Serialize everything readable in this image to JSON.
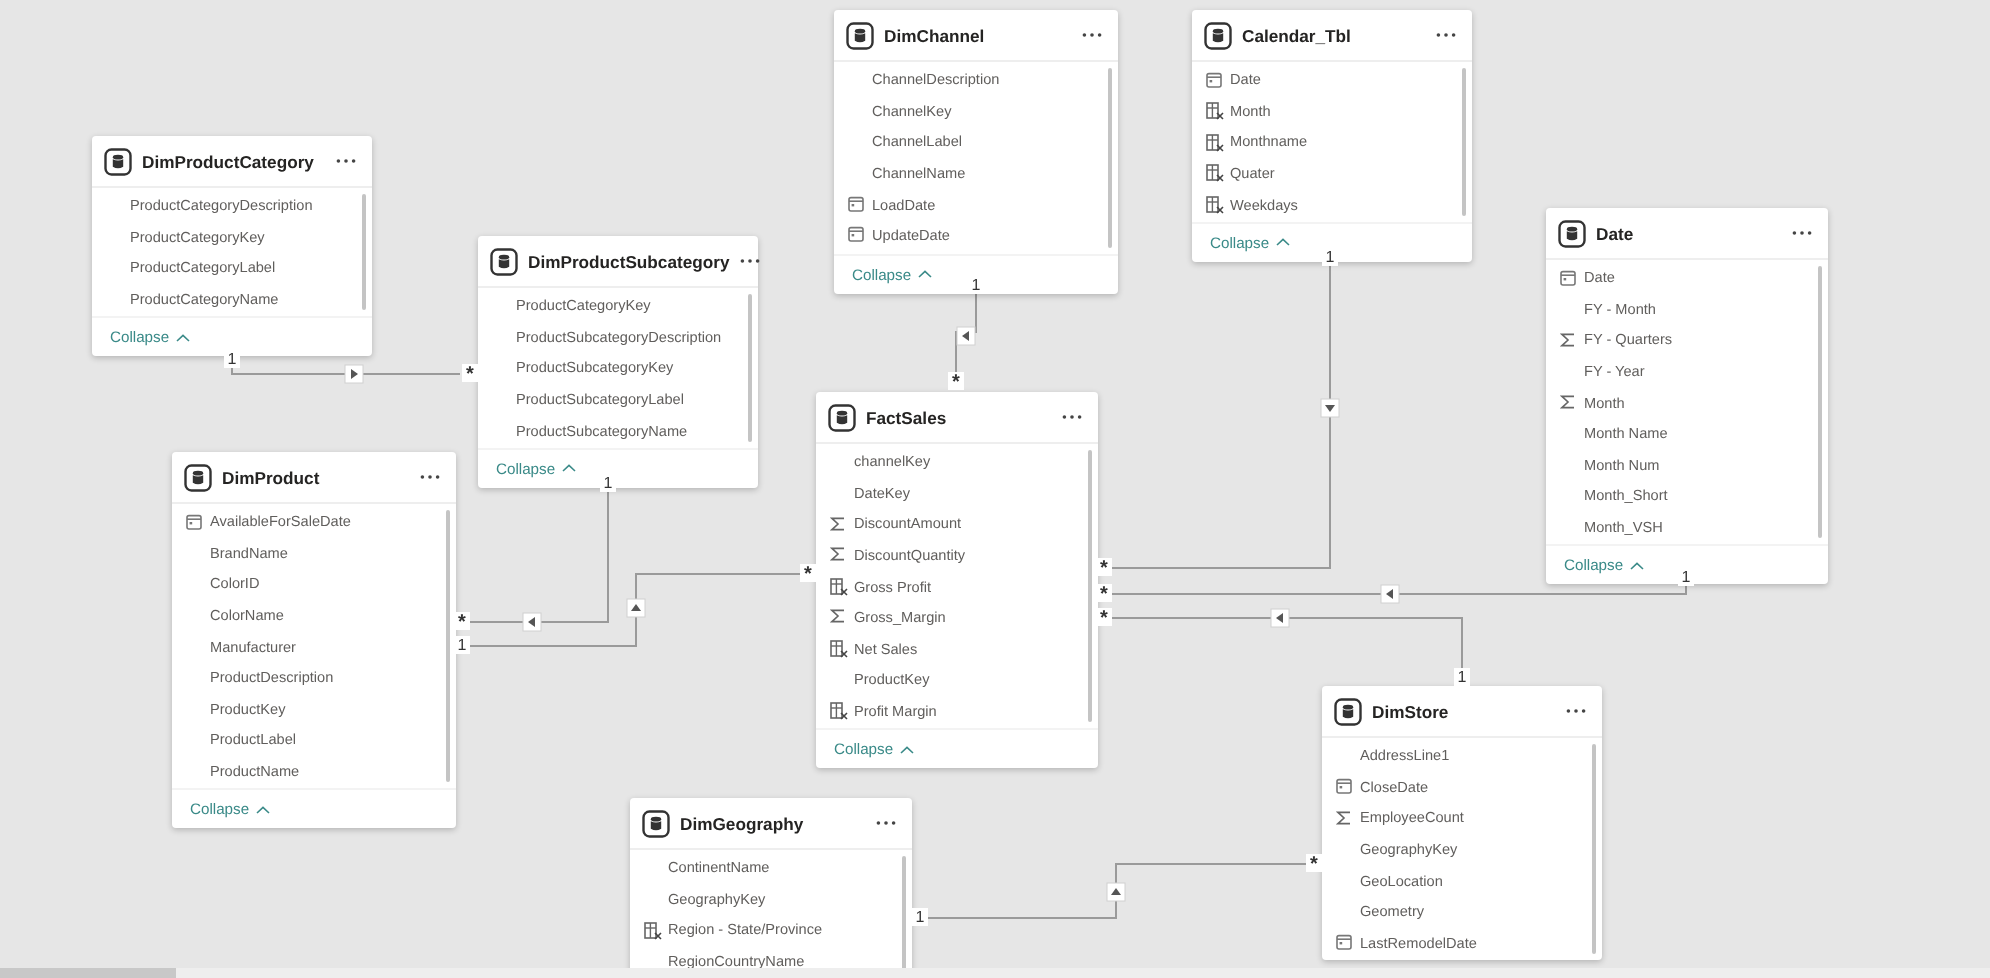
{
  "tables": [
    {
      "name": "DimProductCategory",
      "columns": [
        {
          "name": "ProductCategoryDescription",
          "kind": "plain"
        },
        {
          "name": "ProductCategoryKey",
          "kind": "plain"
        },
        {
          "name": "ProductCategoryLabel",
          "kind": "plain"
        },
        {
          "name": "ProductCategoryName",
          "kind": "plain"
        }
      ],
      "collapse": "Collapse"
    },
    {
      "name": "DimProductSubcategory",
      "columns": [
        {
          "name": "ProductCategoryKey",
          "kind": "plain"
        },
        {
          "name": "ProductSubcategoryDescription",
          "kind": "plain"
        },
        {
          "name": "ProductSubcategoryKey",
          "kind": "plain"
        },
        {
          "name": "ProductSubcategoryLabel",
          "kind": "plain"
        },
        {
          "name": "ProductSubcategoryName",
          "kind": "plain"
        }
      ],
      "collapse": "Collapse"
    },
    {
      "name": "DimProduct",
      "columns": [
        {
          "name": "AvailableForSaleDate",
          "kind": "date"
        },
        {
          "name": "BrandName",
          "kind": "plain"
        },
        {
          "name": "ColorID",
          "kind": "plain"
        },
        {
          "name": "ColorName",
          "kind": "plain"
        },
        {
          "name": "Manufacturer",
          "kind": "plain"
        },
        {
          "name": "ProductDescription",
          "kind": "plain"
        },
        {
          "name": "ProductKey",
          "kind": "plain"
        },
        {
          "name": "ProductLabel",
          "kind": "plain"
        },
        {
          "name": "ProductName",
          "kind": "plain"
        }
      ],
      "collapse": "Collapse"
    },
    {
      "name": "DimChannel",
      "columns": [
        {
          "name": "ChannelDescription",
          "kind": "plain"
        },
        {
          "name": "ChannelKey",
          "kind": "plain"
        },
        {
          "name": "ChannelLabel",
          "kind": "plain"
        },
        {
          "name": "ChannelName",
          "kind": "plain"
        },
        {
          "name": "LoadDate",
          "kind": "date"
        },
        {
          "name": "UpdateDate",
          "kind": "date"
        }
      ],
      "collapse": "Collapse"
    },
    {
      "name": "Calendar_Tbl",
      "columns": [
        {
          "name": "Date",
          "kind": "date"
        },
        {
          "name": "Month",
          "kind": "calc"
        },
        {
          "name": "Monthname",
          "kind": "calc"
        },
        {
          "name": "Quater",
          "kind": "calc"
        },
        {
          "name": "Weekdays",
          "kind": "calc"
        }
      ],
      "collapse": "Collapse"
    },
    {
      "name": "Date",
      "columns": [
        {
          "name": "Date",
          "kind": "date"
        },
        {
          "name": "FY - Month",
          "kind": "plain"
        },
        {
          "name": "FY - Quarters",
          "kind": "sum"
        },
        {
          "name": "FY - Year",
          "kind": "plain"
        },
        {
          "name": "Month",
          "kind": "sum"
        },
        {
          "name": "Month Name",
          "kind": "plain"
        },
        {
          "name": "Month Num",
          "kind": "plain"
        },
        {
          "name": "Month_Short",
          "kind": "plain"
        },
        {
          "name": "Month_VSH",
          "kind": "plain"
        }
      ],
      "collapse": "Collapse"
    },
    {
      "name": "FactSales",
      "columns": [
        {
          "name": "channelKey",
          "kind": "plain"
        },
        {
          "name": "DateKey",
          "kind": "plain"
        },
        {
          "name": "DiscountAmount",
          "kind": "sum"
        },
        {
          "name": "DiscountQuantity",
          "kind": "sum"
        },
        {
          "name": "Gross Profit",
          "kind": "calc"
        },
        {
          "name": "Gross_Margin",
          "kind": "sum"
        },
        {
          "name": "Net Sales",
          "kind": "calc"
        },
        {
          "name": "ProductKey",
          "kind": "plain"
        },
        {
          "name": "Profit Margin",
          "kind": "calc"
        }
      ],
      "collapse": "Collapse"
    },
    {
      "name": "DimStore",
      "columns": [
        {
          "name": "AddressLine1",
          "kind": "plain"
        },
        {
          "name": "CloseDate",
          "kind": "date"
        },
        {
          "name": "EmployeeCount",
          "kind": "sum"
        },
        {
          "name": "GeographyKey",
          "kind": "plain"
        },
        {
          "name": "GeoLocation",
          "kind": "plain"
        },
        {
          "name": "Geometry",
          "kind": "plain"
        },
        {
          "name": "LastRemodelDate",
          "kind": "date"
        }
      ]
    },
    {
      "name": "DimGeography",
      "columns": [
        {
          "name": "ContinentName",
          "kind": "plain"
        },
        {
          "name": "GeographyKey",
          "kind": "plain"
        },
        {
          "name": "Region - State/Province",
          "kind": "calc"
        },
        {
          "name": "RegionCountryName",
          "kind": "plain"
        }
      ]
    }
  ],
  "relationships": [
    {
      "from_end": "1",
      "to_end": "*"
    },
    {
      "from_end": "1",
      "to_end": "*"
    },
    {
      "from_end": "1",
      "to_end": "*"
    },
    {
      "from_end": "1",
      "to_end": "*"
    },
    {
      "from_end": "1",
      "to_end": "*"
    },
    {
      "from_end": "1",
      "to_end": "*"
    },
    {
      "from_end": "1",
      "to_end": "*"
    },
    {
      "from_end": "1",
      "to_end": "*"
    }
  ]
}
